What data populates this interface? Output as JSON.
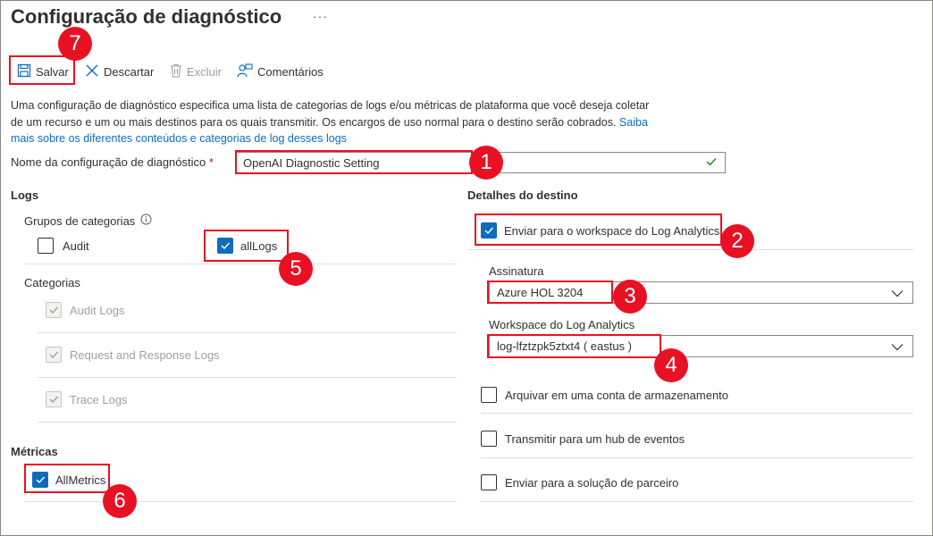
{
  "page": {
    "title": "Configuração de diagnóstico",
    "more_label": "···"
  },
  "toolbar": {
    "save_label": "Salvar",
    "discard_label": "Descartar",
    "delete_label": "Excluir",
    "feedback_label": "Comentários"
  },
  "description": {
    "text": "Uma configuração de diagnóstico especifica uma lista de categorias de logs e/ou métricas de plataforma que você deseja coletar de um recurso e um ou mais destinos para os quais transmitir. Os encargos de uso normal para o destino serão cobrados.",
    "link_text": "Saiba mais sobre os diferentes conteúdos e categorias de log desses logs"
  },
  "setting_name": {
    "label": "Nome da configuração de diagnóstico",
    "required_mark": "*",
    "value": "OpenAI Diagnostic Setting"
  },
  "logs": {
    "heading": "Logs",
    "category_groups_label": "Grupos de categorias",
    "info_icon": "info-icon",
    "groups": [
      {
        "label": "Audit",
        "checked": false
      },
      {
        "label": "allLogs",
        "checked": true
      }
    ],
    "categories_label": "Categorias",
    "categories": [
      {
        "label": "Audit Logs",
        "checked": true,
        "disabled": true
      },
      {
        "label": "Request and Response Logs",
        "checked": true,
        "disabled": true
      },
      {
        "label": "Trace Logs",
        "checked": true,
        "disabled": true
      }
    ]
  },
  "metrics": {
    "heading": "Métricas",
    "items": [
      {
        "label": "AllMetrics",
        "checked": true
      }
    ]
  },
  "destination": {
    "heading": "Detalhes do destino",
    "log_analytics": {
      "label": "Enviar para o workspace do Log Analytics",
      "checked": true
    },
    "subscription": {
      "label": "Assinatura",
      "value": "Azure HOL 3204"
    },
    "workspace": {
      "label": "Workspace do Log Analytics",
      "value": "log-lfztzpk5ztxt4 ( eastus )"
    },
    "archive": {
      "label": "Arquivar em uma conta de armazenamento",
      "checked": false
    },
    "event_hub": {
      "label": "Transmitir para um hub de eventos",
      "checked": false
    },
    "partner": {
      "label": "Enviar para a solução de parceiro",
      "checked": false
    }
  },
  "annotations": [
    "1",
    "2",
    "3",
    "4",
    "5",
    "6",
    "7"
  ],
  "colors": {
    "accent": "#0f6cbd",
    "annotation_red": "#e81123",
    "valid_check": "#107c10"
  }
}
